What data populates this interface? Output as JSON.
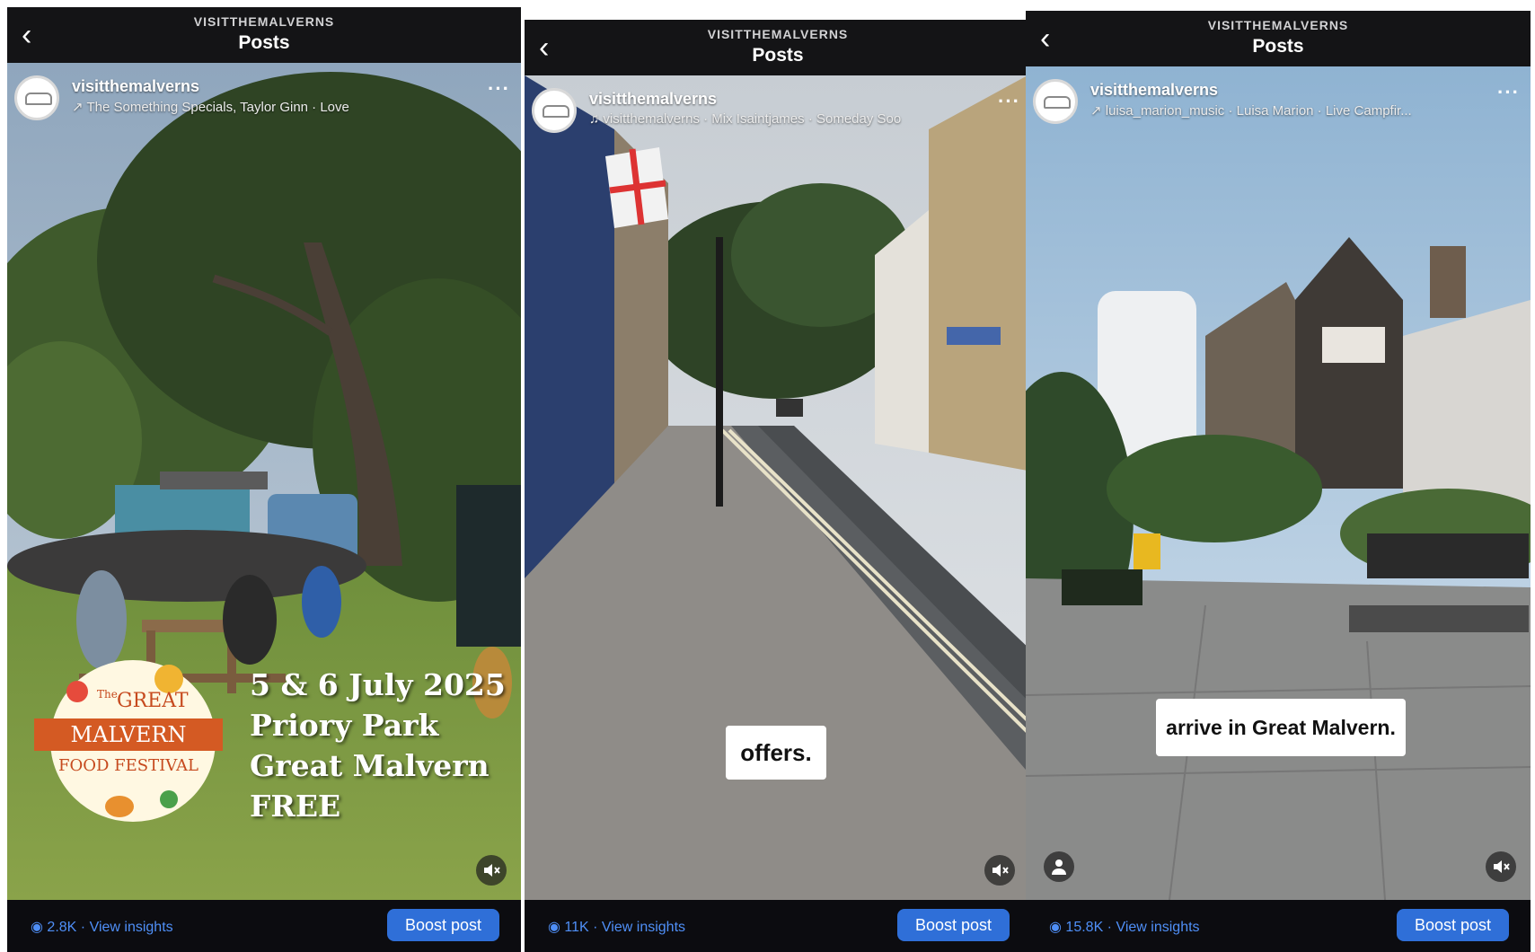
{
  "posts": [
    {
      "account_header": "VISITTHEMALVERNS",
      "title": "Posts",
      "username": "visitthemalverns",
      "audio": "The Something Specials, Taylor Ginn · Love",
      "festival_logo": [
        "The",
        "GREAT",
        "MALVERN",
        "FOOD FESTIVAL"
      ],
      "overlay_lines": [
        "5 & 6 July 2025",
        "Priory Park",
        "Great Malvern",
        "FREE"
      ],
      "views": "2.8K",
      "insights_label": "View insights",
      "boost_label": "Boost post"
    },
    {
      "account_header": "VISITTHEMALVERNS",
      "title": "Posts",
      "username": "visitthemalverns",
      "audio": "visitthemalverns · Mix Isaintjames · Someday Soo",
      "caption": "offers.",
      "views": "11K",
      "insights_label": "View insights",
      "boost_label": "Boost post"
    },
    {
      "account_header": "VISITTHEMALVERNS",
      "title": "Posts",
      "username": "visitthemalverns",
      "audio": "luisa_marion_music · Luisa Marion · Live Campfir...",
      "caption": "arrive in Great Malvern.",
      "views": "15.8K",
      "insights_label": "View insights",
      "boost_label": "Boost post"
    }
  ],
  "colors": {
    "link": "#4f8ff7",
    "boost": "#2f6fd8",
    "bar": "#141416"
  },
  "icons": [
    "back-chevron-icon",
    "more-dots-icon",
    "audio-arrow-icon",
    "music-note-icon",
    "mute-icon",
    "person-icon",
    "eye-icon"
  ]
}
